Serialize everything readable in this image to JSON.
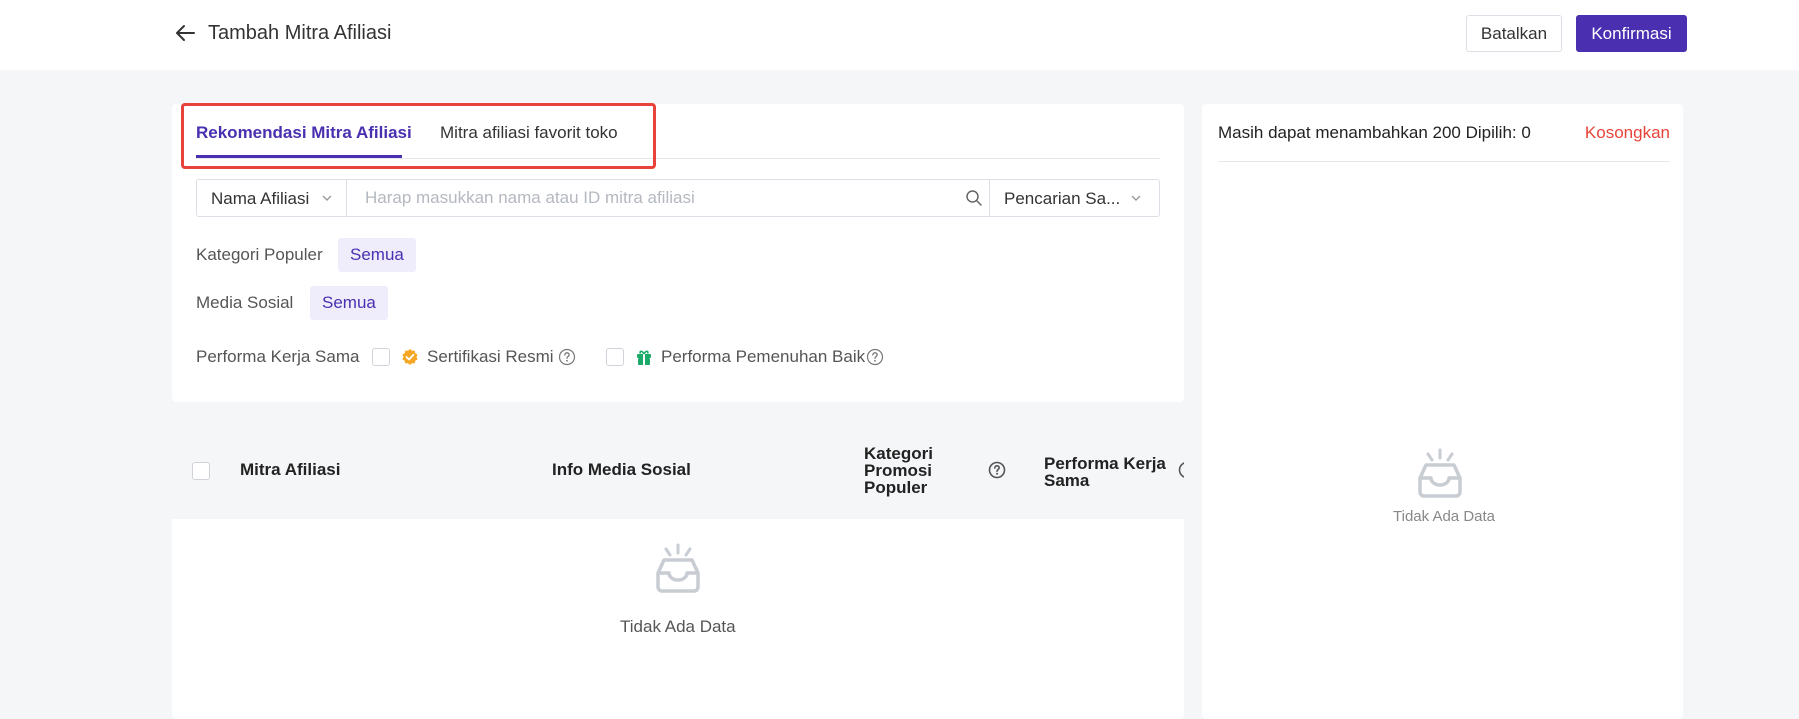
{
  "header": {
    "title": "Tambah Mitra Afiliasi",
    "cancel_label": "Batalkan",
    "confirm_label": "Konfirmasi"
  },
  "tabs": [
    {
      "label": "Rekomendasi Mitra Afiliasi",
      "active": true
    },
    {
      "label": "Mitra afiliasi favorit toko",
      "active": false
    }
  ],
  "search": {
    "type_label": "Nama Afiliasi",
    "placeholder": "Harap masukkan nama atau ID mitra afiliasi",
    "value": "",
    "mode_label": "Pencarian Sa..."
  },
  "filters": {
    "kategori_label": "Kategori Populer",
    "kategori_value": "Semua",
    "media_label": "Media Sosial",
    "media_value": "Semua",
    "performa_label": "Performa Kerja Sama",
    "sertifikasi_label": "Sertifikasi Resmi",
    "pemenuhan_label": "Performa Pemenuhan Baik"
  },
  "table": {
    "columns": [
      "Mitra Afiliasi",
      "Info Media Sosial",
      "Kategori Promosi Populer",
      "Performa Kerja Sama"
    ],
    "rows": [],
    "empty_text": "Tidak Ada Data"
  },
  "selection": {
    "summary": "Masih dapat menambahkan 200 Dipilih: 0",
    "clear_label": "Kosongkan",
    "empty_text": "Tidak Ada Data"
  },
  "colors": {
    "accent": "#4a2fb0",
    "danger": "#e8433a",
    "chip_bg": "#efedfb",
    "certified_badge": "#f5a623",
    "fulfillment_badge": "#1aaa6a"
  }
}
